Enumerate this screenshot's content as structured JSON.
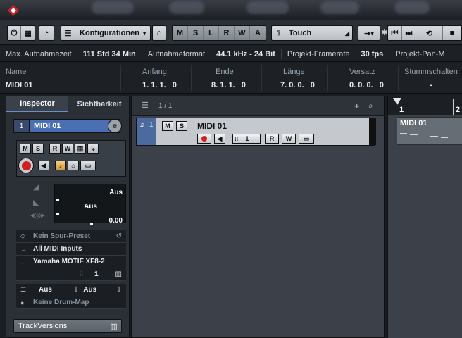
{
  "toolbar": {
    "config_label": "Konfigurationen",
    "m": "M",
    "s": "S",
    "l": "L",
    "r": "R",
    "w": "W",
    "a": "A",
    "automation_mode": "Touch"
  },
  "info_line": {
    "max_rec_label": "Max. Aufnahmezeit",
    "max_rec_value": "111 Std 34 Min",
    "format_label": "Aufnahmeformat",
    "format_value": "44.1 kHz - 24 Bit",
    "framerate_label": "Projekt-Framerate",
    "framerate_value": "30 fps",
    "pan_label": "Projekt-Pan-M"
  },
  "event_line": {
    "name_label": "Name",
    "name_value": "MIDI 01",
    "start_label": "Anfang",
    "start_value": "1. 1. 1.   0",
    "end_label": "Ende",
    "end_value": "8. 1. 1.   0",
    "length_label": "Länge",
    "length_value": "7. 0. 0.   0",
    "offset_label": "Versatz",
    "offset_value": "0. 0. 0.   0",
    "mute_label": "Stummschalten",
    "mute_value": "-"
  },
  "inspector": {
    "tab_inspector": "Inspector",
    "tab_visibility": "Sichtbarkeit",
    "track_number": "1",
    "track_name": "MIDI 01",
    "btn_m": "M",
    "btn_s": "S",
    "btn_r": "R",
    "btn_w": "W",
    "volume_value": "Aus",
    "pan_value": "Aus",
    "delay_value": "0.00",
    "preset": "Kein Spur-Preset",
    "input": "All MIDI Inputs",
    "output": "Yamaha MOTIF XF8-2",
    "channel": "1",
    "bank": "Aus",
    "program": "Aus",
    "drum_map": "Keine Drum-Map",
    "track_versions": "TrackVersions"
  },
  "track_list": {
    "counter": "1 / 1",
    "track_number": "1",
    "track_name": "MIDI 01",
    "btn_m": "M",
    "btn_s": "S",
    "channel": "1",
    "btn_r": "R",
    "btn_w": "W"
  },
  "arrange": {
    "ruler_1": "1",
    "ruler_2": "2",
    "event_name": "MIDI 01"
  }
}
